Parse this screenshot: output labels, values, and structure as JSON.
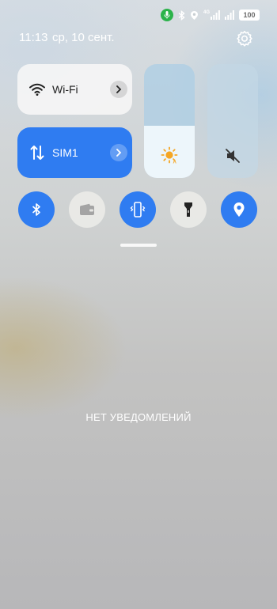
{
  "status_bar": {
    "network_label": "4G",
    "battery": "100"
  },
  "header": {
    "time": "11:13",
    "date": "ср, 10 сент."
  },
  "quick_tiles": {
    "wifi": {
      "label": "Wi-Fi",
      "icon": "wifi-icon"
    },
    "mobile_data": {
      "label": "SIM1",
      "icon": "data-arrows-icon"
    }
  },
  "sliders": {
    "brightness": {
      "level": 0.46,
      "icon": "sun-icon"
    },
    "volume": {
      "level": 0.0,
      "icon": "mute-icon"
    }
  },
  "toggles": [
    {
      "name": "bluetooth",
      "state": "on",
      "icon": "bluetooth-icon"
    },
    {
      "name": "wallet",
      "state": "off",
      "icon": "wallet-icon"
    },
    {
      "name": "vibrate",
      "state": "on",
      "icon": "vibrate-icon"
    },
    {
      "name": "flashlight",
      "state": "off",
      "icon": "flashlight-icon"
    },
    {
      "name": "location",
      "state": "on",
      "icon": "location-icon"
    }
  ],
  "notifications": {
    "empty_text": "НЕТ УВЕДОМЛЕНИЙ"
  },
  "colors": {
    "accent": "#2f7cf1",
    "mic_indicator": "#2bb34a",
    "sun": "#f5a623"
  }
}
